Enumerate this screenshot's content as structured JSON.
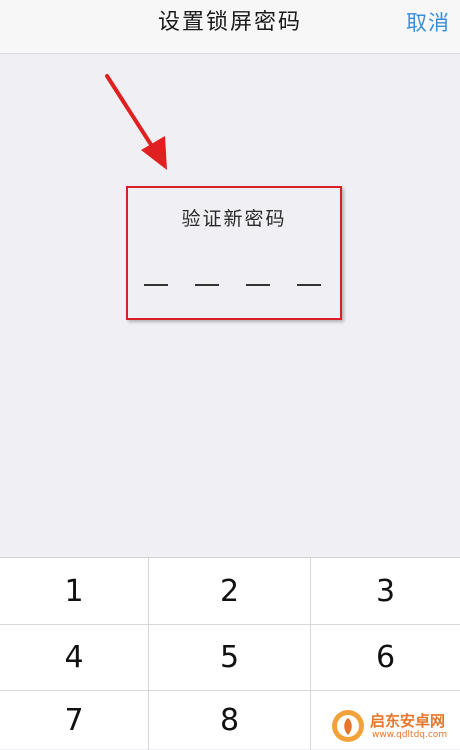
{
  "navbar": {
    "title": "设置锁屏密码",
    "cancel_label": "取消"
  },
  "verify": {
    "label": "验证新密码",
    "pin_length": 4
  },
  "keypad": {
    "keys": [
      "1",
      "2",
      "3",
      "4",
      "5",
      "6",
      "7",
      "8"
    ]
  },
  "watermark": {
    "name": "启东安卓网",
    "url": "www.qdltdq.com"
  },
  "colors": {
    "accent": "#3d8ed9",
    "highlight_border": "#d92027",
    "arrow": "#e02020"
  },
  "icons": {
    "annotation": "red-arrow-icon",
    "watermark_logo": "watermark-logo-icon"
  }
}
